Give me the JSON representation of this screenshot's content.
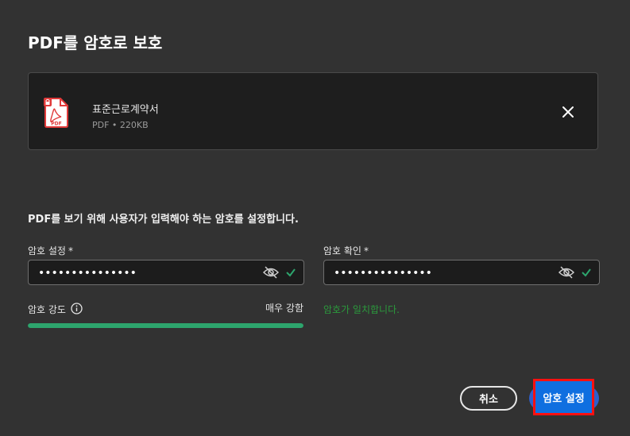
{
  "dialog": {
    "title": "PDF를 암호로 보호"
  },
  "file": {
    "name": "표준근로계약서",
    "meta": "PDF • 220KB",
    "icon_label": "PDF",
    "icon": "pdf-lock-icon"
  },
  "description": "PDF를 보기 위해 사용자가 입력해야 하는 암호를 설정합니다.",
  "password": {
    "label": "암호 설정",
    "required_mark": "*",
    "value": "•••••••••••••••"
  },
  "confirm": {
    "label": "암호 확인",
    "required_mark": "*",
    "value": "•••••••••••••••"
  },
  "strength": {
    "label": "암호 강도",
    "value": "매우 강함",
    "level": 1.0
  },
  "match_message": "암호가 일치합니다.",
  "buttons": {
    "cancel": "취소",
    "submit": "암호 설정"
  },
  "colors": {
    "background": "#323232",
    "card": "#1e1e1e",
    "primary": "#0f6fe0",
    "success": "#2da56d",
    "highlight": "#ff1010",
    "pdf_red": "#e03a3a"
  }
}
